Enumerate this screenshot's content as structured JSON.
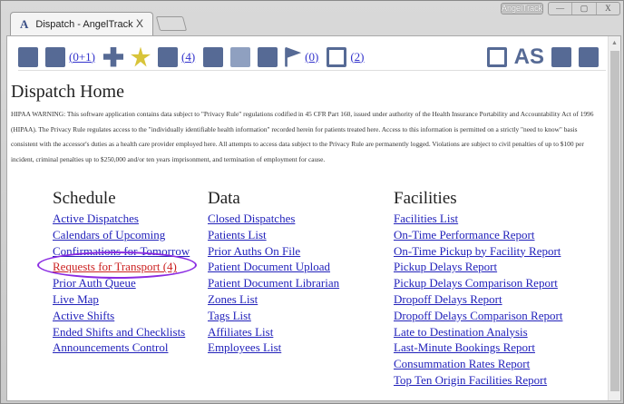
{
  "window": {
    "tab_title": "Dispatch - AngelTrack",
    "tab_close": "X",
    "brand": "AngelTrack",
    "controls": [
      "—",
      "▢",
      "X"
    ]
  },
  "toolbar": {
    "ambulance_count": "(0+1)",
    "staff_count": "(4)",
    "flag_count": "(0)",
    "clock_count": "(2)",
    "as_label": "AS"
  },
  "page": {
    "title": "Dispatch Home",
    "warning": "HIPAA WARNING: This software application contains data subject to \"Privacy Rule\" regulations codified in 45 CFR Part 160, issued under authority of the Health Insurance Portability and Accountability Act of 1996 (HIPAA). The Privacy Rule regulates access to the \"individually identifiable health information\" recorded herein for patients treated here. Access to this information is permitted on a strictly \"need to know\" basis consistent with the accessor's duties as a health care provider employed here. All attempts to access data subject to the Privacy Rule are permanently logged. Violations are subject to civil penalties of up to $100 per incident, criminal penalties up to $250,000 and/or ten years imprisonment, and termination of employment for cause."
  },
  "schedule": {
    "title": "Schedule",
    "items": [
      "Active Dispatches",
      "Calendars of Upcoming",
      "Confirmations for Tomorrow",
      "Requests for Transport (4)",
      "Prior Auth Queue",
      "Live Map",
      "Active Shifts",
      "Ended Shifts and Checklists",
      "Announcements Control"
    ]
  },
  "data": {
    "title": "Data",
    "items": [
      "Closed Dispatches",
      "Patients List",
      "Prior Auths On File",
      "Patient Document Upload",
      "Patient Document Librarian",
      "Zones List",
      "Tags List",
      "Affiliates List",
      "Employees List"
    ]
  },
  "facilities": {
    "title": "Facilities",
    "items": [
      "Facilities List",
      "On-Time Performance Report",
      "On-Time Pickup by Facility Report",
      "Pickup Delays Report",
      "Pickup Delays Comparison Report",
      "Dropoff Delays Report",
      "Dropoff Delays Comparison Report",
      "Late to Destination Analysis",
      "Last-Minute Bookings Report",
      "Consummation Rates Report",
      "Top Ten Origin Facilities Report"
    ]
  }
}
